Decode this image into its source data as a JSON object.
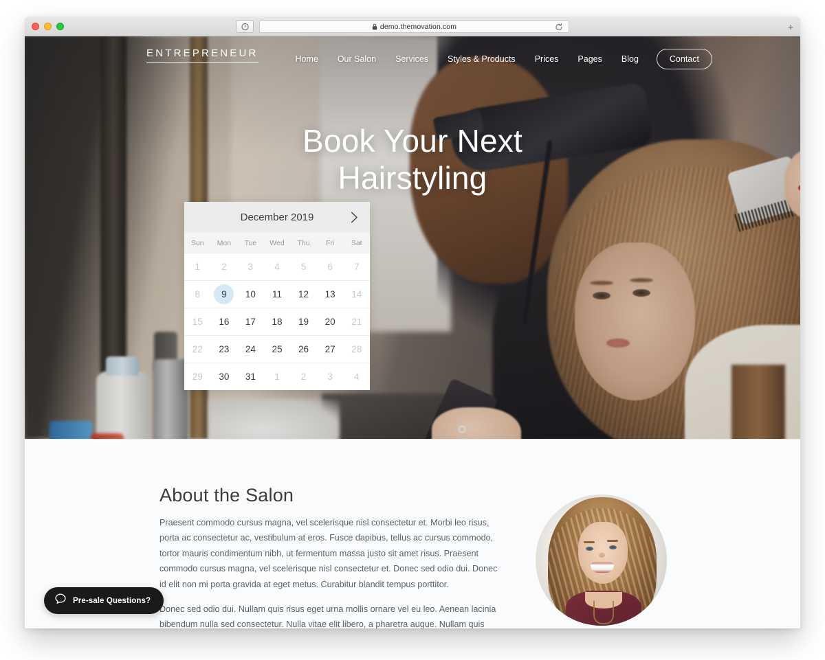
{
  "browser": {
    "url": "demo.themovation.com",
    "lock_icon": "lock-icon",
    "shield_icon": "shield-icon",
    "reload_icon": "reload-icon",
    "newtab_label": "+",
    "traffic_lights": [
      "close",
      "minimize",
      "maximize"
    ]
  },
  "site": {
    "brand": "ENTREPRENEUR",
    "nav": [
      {
        "label": "Home"
      },
      {
        "label": "Our Salon"
      },
      {
        "label": "Services"
      },
      {
        "label": "Styles & Products"
      },
      {
        "label": "Prices"
      },
      {
        "label": "Pages"
      },
      {
        "label": "Blog"
      }
    ],
    "nav_cta": "Contact"
  },
  "hero": {
    "title_line1": "Book Your Next",
    "title_line2": "Hairstyling"
  },
  "calendar": {
    "month_label": "December 2019",
    "next_icon": "chevron-right-icon",
    "prev_icon": "chevron-left-icon",
    "weekdays": [
      "Sun",
      "Mon",
      "Tue",
      "Wed",
      "Thu",
      "Fri",
      "Sat"
    ],
    "selected_day": "9",
    "highlight_color": "#d4e9f4",
    "weeks": [
      [
        {
          "day": "1",
          "muted": true
        },
        {
          "day": "2",
          "muted": true
        },
        {
          "day": "3",
          "muted": true
        },
        {
          "day": "4",
          "muted": true
        },
        {
          "day": "5",
          "muted": true
        },
        {
          "day": "6",
          "muted": true
        },
        {
          "day": "7",
          "muted": true
        }
      ],
      [
        {
          "day": "8",
          "muted": true
        },
        {
          "day": "9",
          "muted": false,
          "selected": true
        },
        {
          "day": "10",
          "muted": false
        },
        {
          "day": "11",
          "muted": false
        },
        {
          "day": "12",
          "muted": false
        },
        {
          "day": "13",
          "muted": false
        },
        {
          "day": "14",
          "muted": true
        }
      ],
      [
        {
          "day": "15",
          "muted": true
        },
        {
          "day": "16",
          "muted": false
        },
        {
          "day": "17",
          "muted": false
        },
        {
          "day": "18",
          "muted": false
        },
        {
          "day": "19",
          "muted": false
        },
        {
          "day": "20",
          "muted": false
        },
        {
          "day": "21",
          "muted": true
        }
      ],
      [
        {
          "day": "22",
          "muted": true
        },
        {
          "day": "23",
          "muted": false
        },
        {
          "day": "24",
          "muted": false
        },
        {
          "day": "25",
          "muted": false
        },
        {
          "day": "26",
          "muted": false
        },
        {
          "day": "27",
          "muted": false
        },
        {
          "day": "28",
          "muted": true
        }
      ],
      [
        {
          "day": "29",
          "muted": true
        },
        {
          "day": "30",
          "muted": false
        },
        {
          "day": "31",
          "muted": false
        },
        {
          "day": "1",
          "muted": true
        },
        {
          "day": "2",
          "muted": true
        },
        {
          "day": "3",
          "muted": true
        },
        {
          "day": "4",
          "muted": true
        }
      ]
    ]
  },
  "about": {
    "title": "About the Salon",
    "paragraph1": "Praesent commodo cursus magna, vel scelerisque nisl consectetur et. Morbi leo risus, porta ac consectetur ac, vestibulum at eros. Fusce dapibus, tellus ac cursus commodo, tortor mauris condimentum nibh, ut fermentum massa justo sit amet risus. Praesent commodo cursus magna, vel scelerisque nisl consectetur et. Donec sed odio dui. Donec id elit non mi porta gravida at eget metus. Curabitur blandit tempus porttitor.",
    "paragraph2": "Donec sed odio dui. Nullam quis risus eget urna mollis ornare vel eu leo. Aenean lacinia bibendum nulla sed consectetur. Nulla vitae elit libero, a pharetra augue. Nullam quis risus eget urna mollis ornare vel eu leo.",
    "avatar_alt": "portrait-photo"
  },
  "chat": {
    "label": "Pre-sale Questions?",
    "icon": "chat-bubble-icon",
    "background": "#1a1a1a"
  }
}
